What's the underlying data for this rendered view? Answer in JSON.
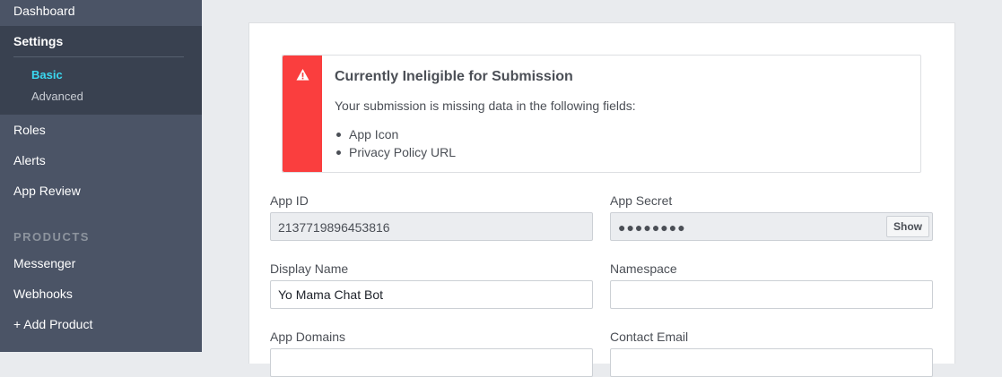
{
  "sidebar": {
    "items_top": [
      {
        "label": "Dashboard"
      },
      {
        "label": "Settings"
      }
    ],
    "settings_subitems": [
      {
        "label": "Basic",
        "active": true
      },
      {
        "label": "Advanced",
        "active": false
      }
    ],
    "items_mid": [
      {
        "label": "Roles"
      },
      {
        "label": "Alerts"
      },
      {
        "label": "App Review"
      }
    ],
    "products_header": "PRODUCTS",
    "products": [
      {
        "label": "Messenger"
      },
      {
        "label": "Webhooks"
      },
      {
        "label": "+ Add Product"
      }
    ]
  },
  "alert": {
    "icon": "warning-icon",
    "title": "Currently Ineligible for Submission",
    "message": "Your submission is missing data in the following fields:",
    "missing_fields": [
      "App Icon",
      "Privacy Policy URL"
    ],
    "accent_color": "#fa3e3e"
  },
  "form": {
    "app_id_label": "App ID",
    "app_id_value": "2137719896453816",
    "app_secret_label": "App Secret",
    "app_secret_value": "●●●●●●●●",
    "show_label": "Show",
    "display_name_label": "Display Name",
    "display_name_value": "Yo Mama Chat Bot",
    "namespace_label": "Namespace",
    "namespace_value": "",
    "app_domains_label": "App Domains",
    "contact_email_label": "Contact Email"
  },
  "colors": {
    "sidebar_bg": "#4b5466",
    "sidebar_active_bg": "#394150",
    "active_subitem": "#3ad8f0",
    "page_bg": "#e9ebee"
  }
}
